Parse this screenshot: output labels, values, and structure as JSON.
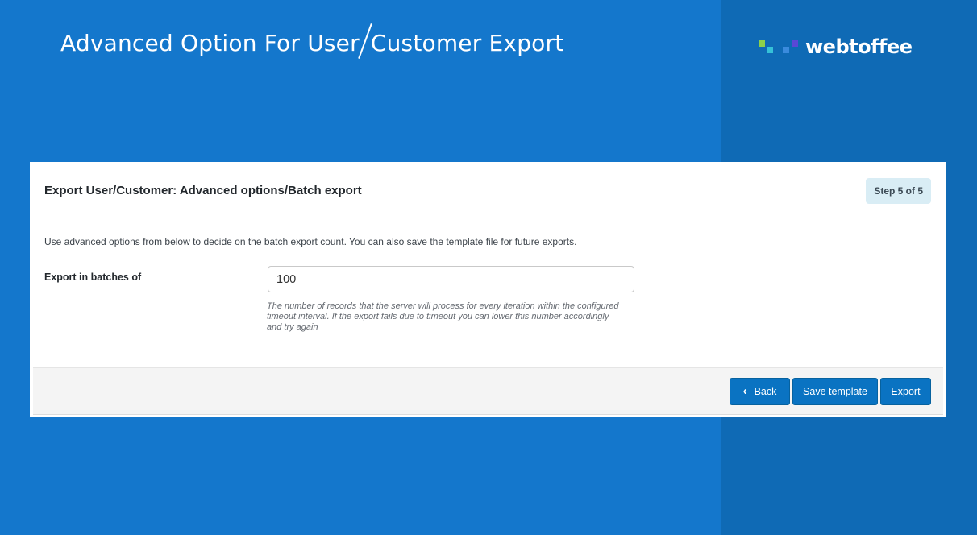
{
  "hero": {
    "title_part1": "Advanced Option For User",
    "title_part2": "Customer Export"
  },
  "brand": {
    "name": "webtoffee",
    "mark_colors": [
      "#8cd14a",
      "#35c1d8",
      "#3a8bdd",
      "#5a48d6"
    ]
  },
  "card": {
    "title": "Export User/Customer: Advanced options/Batch export",
    "step_badge": "Step 5 of 5",
    "intro": "Use advanced options from below to decide on the batch export count. You can also save the template file for future exports.",
    "batch_field": {
      "label": "Export in batches of",
      "value": "100",
      "help": "The number of records that the server will process for every iteration within the configured timeout interval. If the export fails due to timeout you can lower this number accordingly and try again"
    }
  },
  "footer": {
    "back_label": "Back",
    "back_icon": "chevron-left-icon",
    "save_label": "Save template",
    "export_label": "Export"
  },
  "colors": {
    "background": "#1477cc",
    "right_band": "#0f6ab5",
    "button": "#0a73c2",
    "badge": "#d9edf5"
  }
}
